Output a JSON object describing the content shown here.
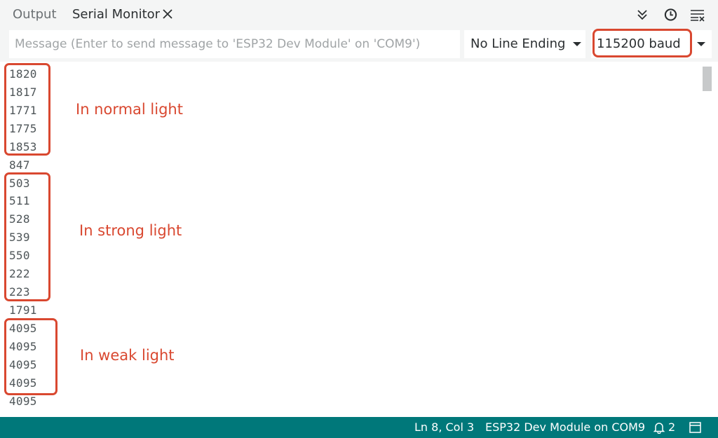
{
  "tabs": {
    "output": "Output",
    "serial_monitor": "Serial Monitor"
  },
  "toolbar": {
    "message_placeholder": "Message (Enter to send message to 'ESP32 Dev Module' on 'COM9')",
    "line_ending": "No Line Ending",
    "baud_rate": "115200 baud"
  },
  "serial_lines": [
    "1820",
    "1817",
    "1771",
    "1775",
    "1853",
    "847",
    "503",
    "511",
    "528",
    "539",
    "550",
    "222",
    "223",
    "1791",
    "4095",
    "4095",
    "4095",
    "4095",
    "4095"
  ],
  "annotations": {
    "normal": "In normal light",
    "strong": "In strong light",
    "weak": "In weak light"
  },
  "status": {
    "cursor": "Ln 8, Col 3",
    "board": "ESP32 Dev Module on COM9",
    "notifications": "2"
  },
  "colors": {
    "accent": "#d94830",
    "statusbar": "#00787a"
  }
}
